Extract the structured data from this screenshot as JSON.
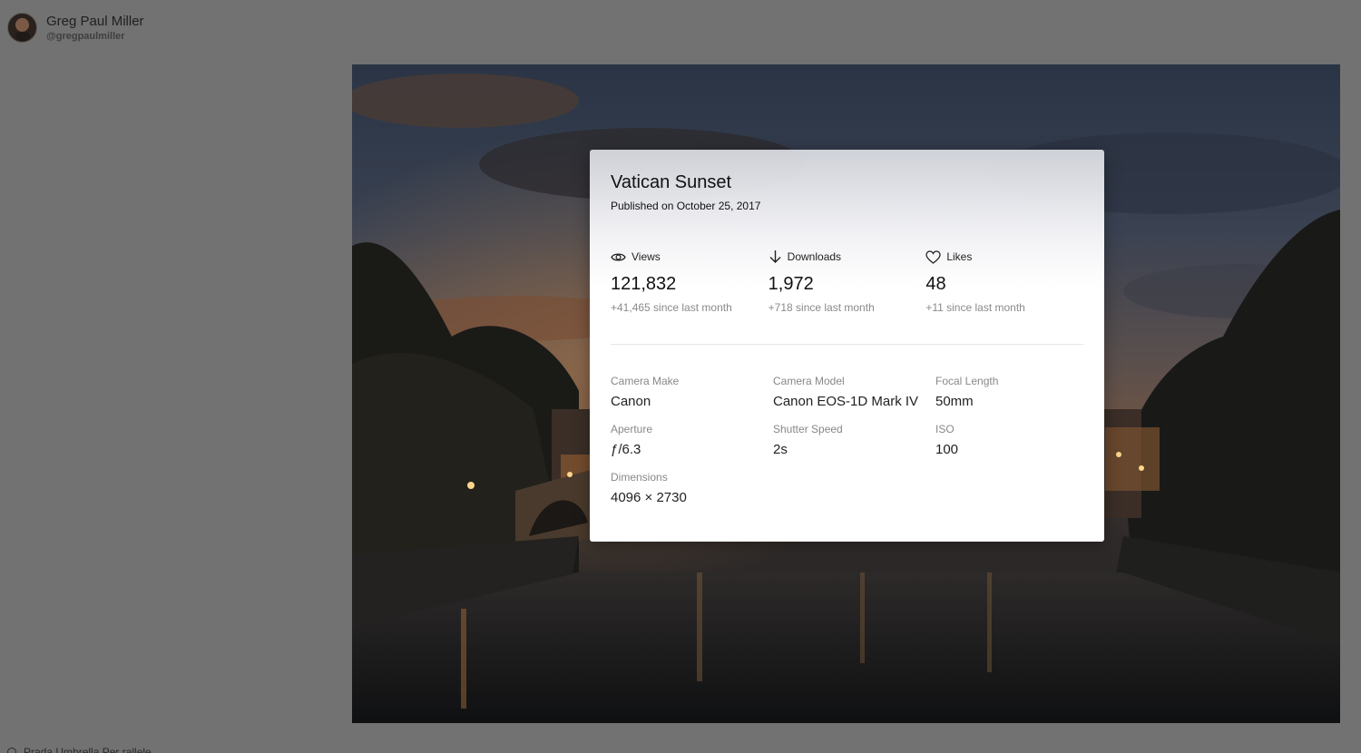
{
  "author": {
    "name": "Greg Paul Miller",
    "handle": "@gregpaulmiller"
  },
  "bottom_strip": {
    "text": "Prada Umbrella Per rallele"
  },
  "photo_info": {
    "title": "Vatican Sunset",
    "published": "Published on October 25, 2017",
    "stats": [
      {
        "icon": "eye-icon",
        "label": "Views",
        "value": "121,832",
        "change": "+41,465 since last month"
      },
      {
        "icon": "download-arrow-icon",
        "label": "Downloads",
        "value": "1,972",
        "change": "+718 since last month"
      },
      {
        "icon": "heart-icon",
        "label": "Likes",
        "value": "48",
        "change": "+11 since last month"
      }
    ],
    "specs": [
      {
        "label": "Camera Make",
        "value": "Canon"
      },
      {
        "label": "Camera Model",
        "value": "Canon EOS-1D Mark IV"
      },
      {
        "label": "Focal Length",
        "value": "50mm"
      },
      {
        "label": "Aperture",
        "value": "ƒ/6.3"
      },
      {
        "label": "Shutter Speed",
        "value": "2s"
      },
      {
        "label": "ISO",
        "value": "100"
      },
      {
        "label": "Dimensions",
        "value": "4096 × 2730"
      }
    ]
  },
  "colors": {
    "backdrop": "#727272",
    "card": "#ffffff",
    "muted_text": "#888888"
  }
}
